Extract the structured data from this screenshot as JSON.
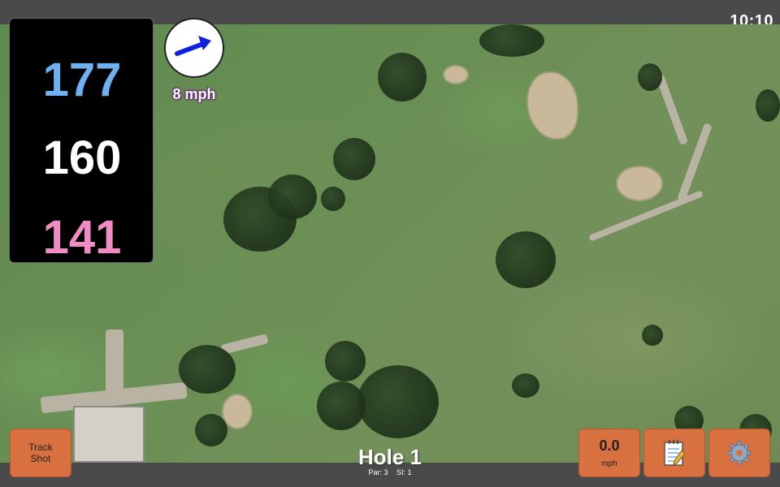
{
  "status_bar": {
    "time": "10:10"
  },
  "yardages": {
    "back": "177",
    "middle": "160",
    "front": "141"
  },
  "wind": {
    "speed_label": "8 mph",
    "direction_icon": "arrow-up-right-icon",
    "arrow_color": "#1020e0"
  },
  "buttons": {
    "track_shot_label": "Track Shot",
    "speed_value": "0.0",
    "speed_unit": "mph",
    "notes_icon": "notepad-icon",
    "settings_icon": "gear-icon"
  },
  "hole": {
    "title": "Hole 1",
    "par": "Par: 3",
    "si": "SI: 1"
  },
  "colors": {
    "back_yardage": "#6fb0f3",
    "middle_yardage": "#ffffff",
    "front_yardage": "#f08bc3",
    "button_orange": "#d9703f"
  }
}
